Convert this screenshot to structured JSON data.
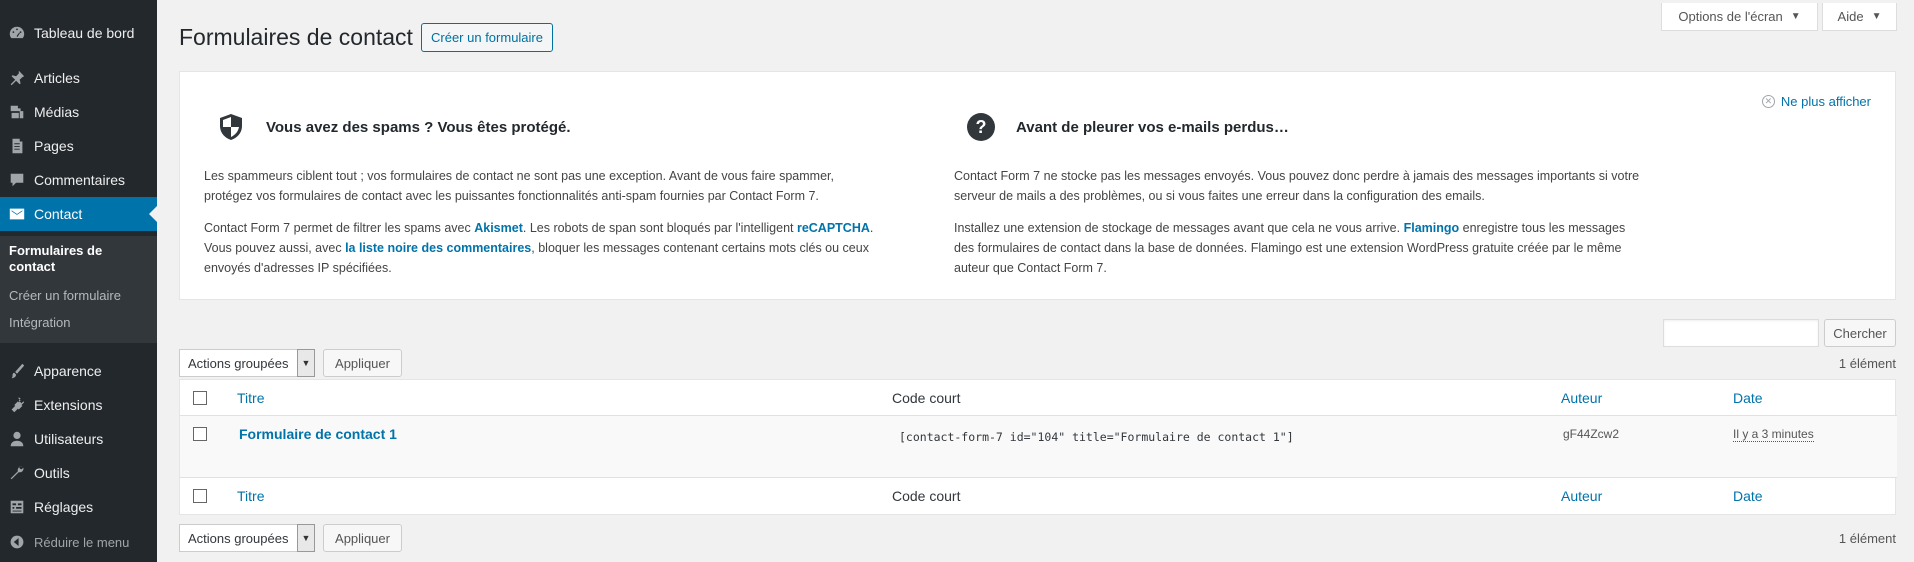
{
  "sidebar": {
    "items": [
      {
        "label": "Tableau de bord",
        "icon": "dashboard-icon"
      },
      {
        "label": "Articles",
        "icon": "pin-icon"
      },
      {
        "label": "Médias",
        "icon": "media-icon"
      },
      {
        "label": "Pages",
        "icon": "pages-icon"
      },
      {
        "label": "Commentaires",
        "icon": "comments-icon"
      },
      {
        "label": "Contact",
        "icon": "mail-icon"
      },
      {
        "label": "Apparence",
        "icon": "brush-icon"
      },
      {
        "label": "Extensions",
        "icon": "plugin-icon"
      },
      {
        "label": "Utilisateurs",
        "icon": "users-icon"
      },
      {
        "label": "Outils",
        "icon": "wrench-icon"
      },
      {
        "label": "Réglages",
        "icon": "settings-icon"
      }
    ],
    "submenu": [
      "Formulaires de contact",
      "Créer un formulaire",
      "Intégration"
    ],
    "collapse_label": "Réduire le menu"
  },
  "screen_meta": {
    "options_label": "Options de l'écran",
    "help_label": "Aide"
  },
  "header": {
    "title": "Formulaires de contact",
    "add_new_label": "Créer un formulaire"
  },
  "welcome": {
    "dismiss_label": "Ne plus afficher",
    "spam": {
      "title": "Vous avez des spams ? Vous êtes protégé.",
      "p1_line1": "Les spammeurs ciblent tout ; vos formulaires de contact ne sont pas une exception. Avant de vous faire spammer,",
      "p1_line2": "protégez vos formulaires de contact avec les puissantes fonctionnalités anti-spam fournies par Contact Form 7.",
      "p2_a": "Contact Form 7 permet de filtrer les spams avec ",
      "p2_akismet": "Akismet",
      "p2_b": ". Les robots de span sont bloqués par l'intelligent ",
      "p2_recaptcha": "reCAPTCHA",
      "p2_c": ".",
      "p2_d": "Vous pouvez aussi, avec ",
      "p2_blacklist": "la liste noire des commentaires",
      "p2_e": ", bloquer les messages contenant certains mots clés ou ceux",
      "p2_f": "envoyés d'adresses IP spécifiées."
    },
    "lost": {
      "title": "Avant de pleurer vos e-mails perdus…",
      "p1_line1": "Contact Form 7 ne stocke pas les messages envoyés. Vous pouvez donc perdre à jamais des messages importants si votre",
      "p1_line2": "serveur de mails a des problèmes, ou si vous faites une erreur dans la configuration des emails.",
      "p2_a": "Installez une extension de stockage de messages avant que cela ne vous arrive. ",
      "p2_flamingo": "Flamingo",
      "p2_b": " enregistre tous les messages",
      "p2_c": "des formulaires de contact dans la base de données. Flamingo est une extension WordPress gratuite créée par le même",
      "p2_d": "auteur que Contact Form 7."
    }
  },
  "search": {
    "button_label": "Chercher"
  },
  "bulk": {
    "selected": "Actions groupées",
    "apply_label": "Appliquer",
    "count": "1 élément"
  },
  "table": {
    "headers": {
      "title": "Titre",
      "shortcode": "Code court",
      "author": "Auteur",
      "date": "Date"
    },
    "rows": [
      {
        "title": "Formulaire de contact 1",
        "shortcode": "[contact-form-7 id=\"104\" title=\"Formulaire de contact 1\"]",
        "author": "gF44Zcw2",
        "date": "Il y a 3 minutes"
      }
    ]
  },
  "colors": {
    "accent": "#0073aa",
    "sidebar_bg": "#23282d",
    "submenu_bg": "#32373c"
  }
}
